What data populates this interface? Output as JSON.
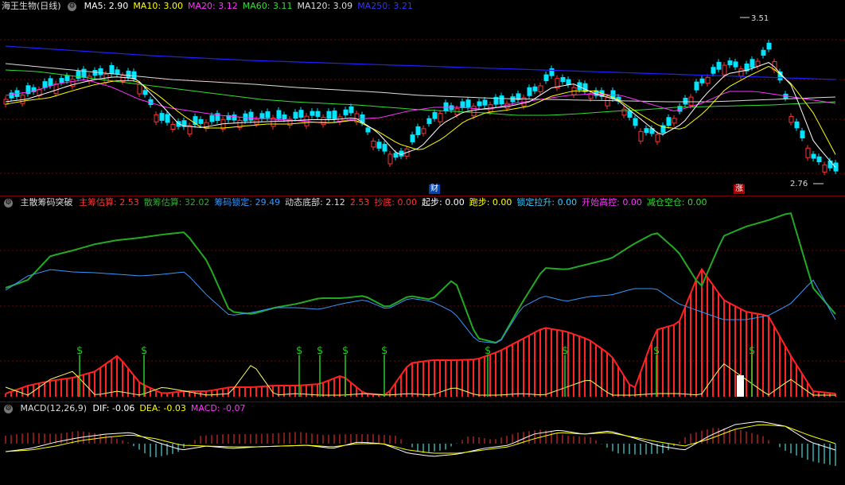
{
  "main": {
    "title": "海王生物(日线)",
    "ma": [
      {
        "label": "MA5:",
        "value": "2.90",
        "color": "#ffffff"
      },
      {
        "label": "MA10:",
        "value": "3.00",
        "color": "#ffff00"
      },
      {
        "label": "MA20:",
        "value": "3.12",
        "color": "#ff33ff"
      },
      {
        "label": "MA60:",
        "value": "3.11",
        "color": "#33dd33"
      },
      {
        "label": "MA120:",
        "value": "3.09",
        "color": "#dddddd"
      },
      {
        "label": "MA250:",
        "value": "3.21",
        "color": "#3333ff"
      }
    ],
    "high_note": "3.51",
    "low_note": "2.76",
    "badge_cai": "财",
    "badge_zhang": "涨"
  },
  "chip": {
    "title": "主散筹码突破",
    "items": [
      {
        "label": "主筹估算:",
        "value": "2.53",
        "color": "#ff3333"
      },
      {
        "label": "散筹估算:",
        "value": "32.02",
        "color": "#33aa33"
      },
      {
        "label": "筹码锁定:",
        "value": "29.49",
        "color": "#3399ff"
      },
      {
        "label": "动态底部:",
        "value": "2.12",
        "color": "#dddddd"
      },
      {
        "label": "",
        "value": "2.53",
        "color": "#ff3333"
      },
      {
        "label": "抄底:",
        "value": "0.00",
        "color": "#ff3333"
      },
      {
        "label": "起步:",
        "value": "0.00",
        "color": "#ffffff"
      },
      {
        "label": "跑步:",
        "value": "0.00",
        "color": "#ffff00"
      },
      {
        "label": "锁定拉升:",
        "value": "0.00",
        "color": "#33ccff"
      },
      {
        "label": "开始高控:",
        "value": "0.00",
        "color": "#ff33ff"
      },
      {
        "label": "减仓空仓:",
        "value": "0.00",
        "color": "#33dd33"
      }
    ],
    "dollar": "$"
  },
  "macd": {
    "title": "MACD(12,26,9)",
    "items": [
      {
        "label": "DIF:",
        "value": "-0.06",
        "color": "#ffffff"
      },
      {
        "label": "DEA:",
        "value": "-0.03",
        "color": "#ffff00"
      },
      {
        "label": "MACD:",
        "value": "-0.07",
        "color": "#ff33ff"
      }
    ]
  },
  "colors": {
    "up": "#ff3333",
    "down": "#00e5ff",
    "ma250": "#2020ff",
    "separator": "#7a0000"
  }
}
